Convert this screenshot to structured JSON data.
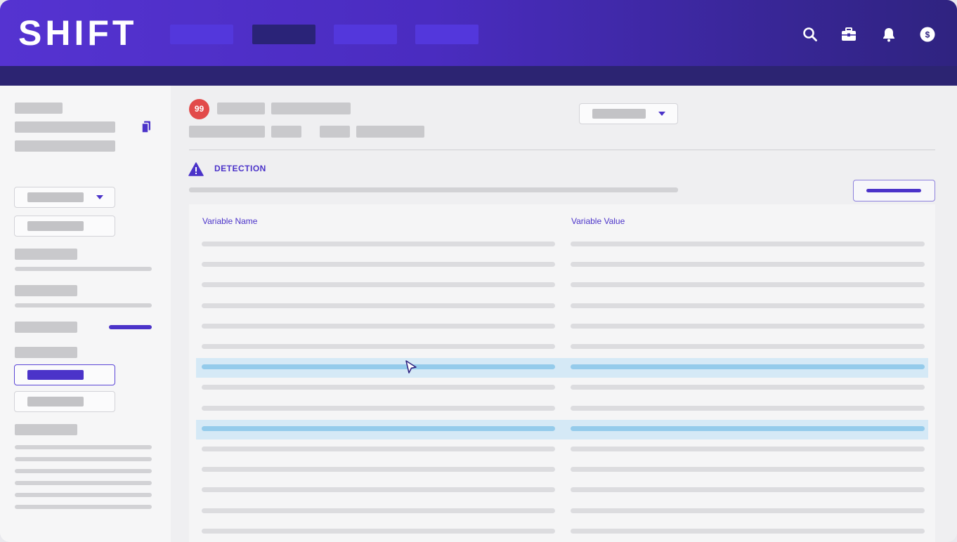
{
  "app": {
    "logo": "SHIFT",
    "colors": {
      "brand": "#5533d1",
      "header_dark": "#2c2472",
      "accent": "#4b33c9",
      "badge": "#e24a4a",
      "highlight_row": "#d5e9f6",
      "highlight_cell": "#94cbeb"
    }
  },
  "header": {
    "nav_tabs": [
      {
        "name": "nav-tab-1",
        "state": "default"
      },
      {
        "name": "nav-tab-2",
        "state": "selected"
      },
      {
        "name": "nav-tab-3",
        "state": "default"
      },
      {
        "name": "nav-tab-4",
        "state": "default"
      }
    ],
    "icons": [
      "search-icon",
      "toolbox-icon",
      "bell-icon",
      "dollar-icon"
    ]
  },
  "main": {
    "badge": "99",
    "section_title": "DETECTION",
    "table": {
      "columns": [
        "Variable Name",
        "Variable Value"
      ],
      "highlighted_rows": [
        7,
        10
      ]
    }
  }
}
